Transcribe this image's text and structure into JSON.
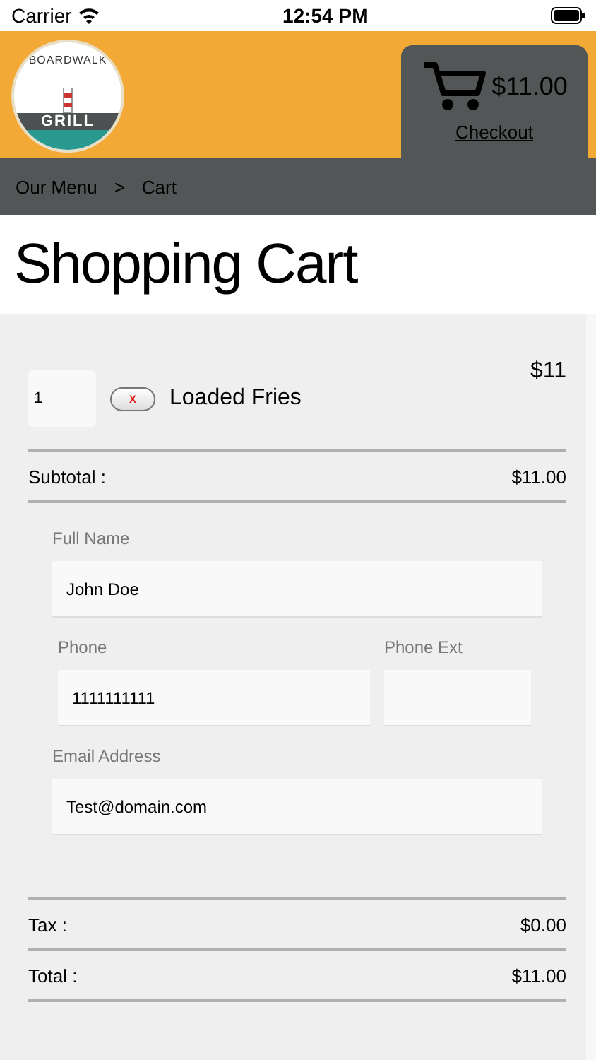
{
  "status_bar": {
    "carrier": "Carrier",
    "time": "12:54 PM"
  },
  "logo": {
    "top": "BOARDWALK",
    "bottom": "GRILL"
  },
  "cart_tab": {
    "total": "$11.00",
    "link": "Checkout"
  },
  "breadcrumb": [
    "Our Menu",
    ">",
    "Cart"
  ],
  "title": "Shopping Cart",
  "items": [
    {
      "quantity": "1",
      "remove": "x",
      "name": "Loaded Fries",
      "price": "$11"
    }
  ],
  "subtotal": {
    "label": "Subtotal :",
    "value": "$11.00"
  },
  "form_rows": [
    [
      {
        "label": "Full Name",
        "value": "John Doe"
      }
    ],
    [
      {
        "label": "Phone",
        "value": "1111111111"
      },
      {
        "label": "Phone Ext"
      }
    ],
    [
      {
        "label": "Email Address",
        "value": "Test@domain.com"
      }
    ]
  ],
  "totals": [
    {
      "label": "Tax :",
      "value": "$0.00"
    },
    {
      "label": "Total :",
      "value": "$11.00"
    }
  ]
}
